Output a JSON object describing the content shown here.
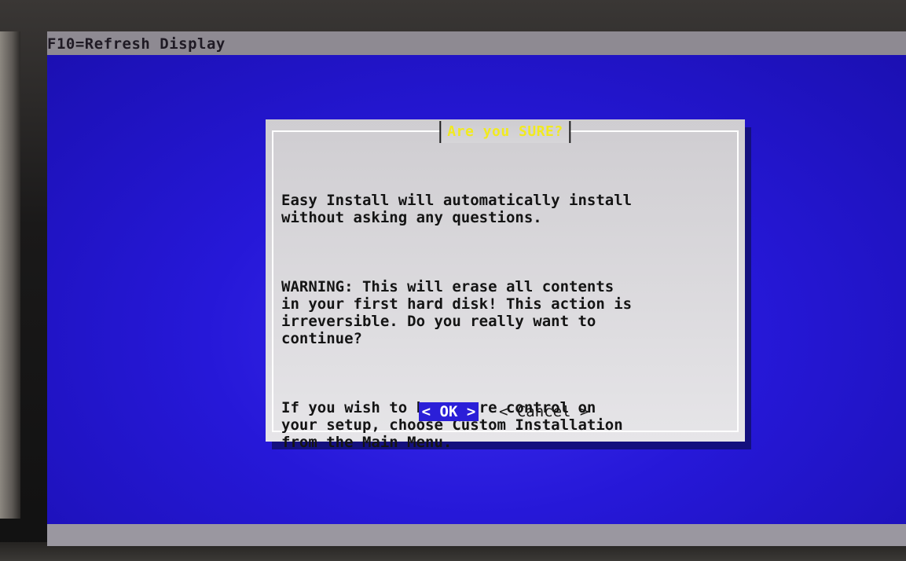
{
  "screen": {
    "top_hint": "F10=Refresh Display"
  },
  "dialog": {
    "title": "Are you SURE?",
    "paragraphs": [
      "Easy Install will automatically install\nwithout asking any questions.",
      "WARNING: This will erase all contents\nin your first hard disk! This action is\nirreversible. Do you really want to\ncontinue?",
      "If you wish to have more control on\nyour setup, choose Custom Installation\nfrom the Main Menu."
    ],
    "buttons": {
      "ok_label": "< OK >",
      "cancel_label": "< Cancel >"
    }
  },
  "colors": {
    "screen_background": "#1e12c8",
    "dialog_background": "#d9d8dc",
    "title_color": "#f1ea1f",
    "selected_button_background": "#2b1fd8"
  }
}
